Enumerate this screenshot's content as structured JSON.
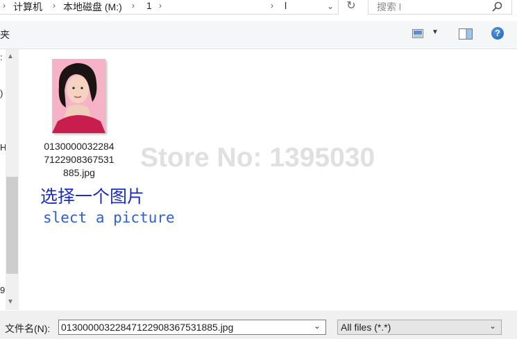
{
  "address_bar": {
    "crumbs": [
      "计算机",
      "本地磁盘 (M:)",
      "1",
      "l"
    ],
    "dropdown_glyph": "⌄",
    "refresh_glyph": "↻"
  },
  "search": {
    "placeholder": "搜索 l"
  },
  "toolbar": {
    "left_label": "夹"
  },
  "nav": {
    "fragments": [
      ":",
      ")",
      "H",
      "9"
    ]
  },
  "files": [
    {
      "name": "01300000322847122908367531885.jpg",
      "name_lines": [
        "0130000032284",
        "7122908367531",
        "885.jpg"
      ]
    }
  ],
  "watermark": "Store No: 1395030",
  "captions": {
    "chinese": "选择一个图片",
    "english": "slect a picture"
  },
  "bottom": {
    "file_name_label": "文件名(N):",
    "file_name_value": "01300000322847122908367531885.jpg",
    "filter_value": "All files (*.*)"
  },
  "colors": {
    "caption_cn": "#1f2fb5",
    "caption_en": "#2e5fd0",
    "watermark": "#e0e0e0",
    "help_icon": "#1a5bb5"
  }
}
